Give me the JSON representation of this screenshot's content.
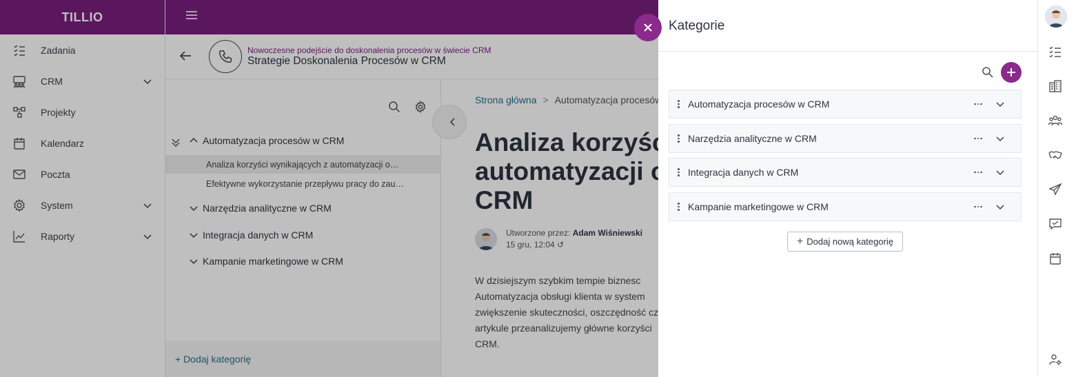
{
  "app": {
    "logo": "TILLIO"
  },
  "sidebar": {
    "items": [
      {
        "label": "Zadania",
        "icon": "tasks-icon",
        "has_chevron": false
      },
      {
        "label": "CRM",
        "icon": "crm-icon",
        "has_chevron": true
      },
      {
        "label": "Projekty",
        "icon": "projects-icon",
        "has_chevron": false
      },
      {
        "label": "Kalendarz",
        "icon": "calendar-icon",
        "has_chevron": false
      },
      {
        "label": "Poczta",
        "icon": "mail-icon",
        "has_chevron": false
      },
      {
        "label": "System",
        "icon": "gear-icon",
        "has_chevron": true
      },
      {
        "label": "Raporty",
        "icon": "chart-icon",
        "has_chevron": true
      }
    ]
  },
  "header": {
    "subtitle": "Nowoczesne podejście do doskonalenia procesów w świecie CRM",
    "title": "Strategie Doskonalenia Procesów w CRM"
  },
  "tree": {
    "nodes": [
      {
        "label": "Automatyzacja procesów w CRM",
        "expanded": true
      },
      {
        "label": "Narzędzia analityczne w CRM",
        "expanded": false
      },
      {
        "label": "Integracja danych w CRM",
        "expanded": false
      },
      {
        "label": "Kampanie marketingowe w CRM",
        "expanded": false
      }
    ],
    "leaves": [
      {
        "label": "Analiza korzyści wynikających z automatyzacji o…",
        "selected": true
      },
      {
        "label": "Efektywne wykorzystanie przepływu pracy do zau…",
        "selected": false
      }
    ],
    "add_label": "+ Dodaj kategorię"
  },
  "article": {
    "breadcrumb_home": "Strona główna",
    "breadcrumb_sep": ">",
    "breadcrumb_current": "Automatyzacja procesów",
    "title": "Analiza korzyści automatyzacji ob CRM",
    "title_lines": [
      "Analiza korzyści",
      "automatyzacji ob",
      "CRM"
    ],
    "author_prefix": "Utworzone przez:",
    "author_name": "Adam Wiśniewski",
    "date": "15 gru, 12:04",
    "body_lines": [
      "W dzisiejszym szybkim tempie biznesc",
      "Automatyzacja obsługi klienta w system",
      "zwiększenie skuteczności, oszczędność cz",
      "artykule przeanalizujemy główne korzyści",
      "CRM."
    ]
  },
  "drawer": {
    "title": "Kategorie",
    "categories": [
      {
        "label": "Automatyzacja procesów w CRM"
      },
      {
        "label": "Narzędzia analityczne w CRM"
      },
      {
        "label": "Integracja danych w CRM"
      },
      {
        "label": "Kampanie marketingowe w CRM"
      }
    ],
    "add_button": "Dodaj nową kategorię"
  },
  "rail": {
    "icons": [
      "tasks-icon",
      "building-icon",
      "contacts-icon",
      "handshake-icon",
      "send-icon",
      "chat-check-icon",
      "calendar-icon",
      "settings-person-icon"
    ]
  },
  "colors": {
    "brand": "#7a1f7e",
    "accent": "#8a2a8d",
    "link": "#2a6f8a"
  }
}
